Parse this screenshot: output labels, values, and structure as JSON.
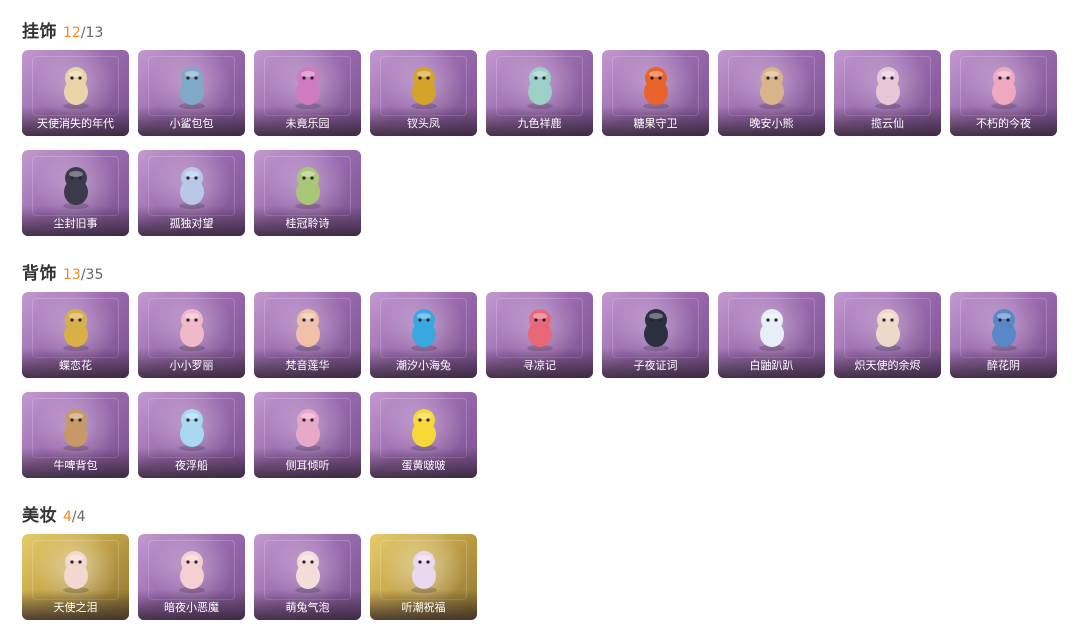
{
  "sections": [
    {
      "title": "挂饰",
      "owned": "12",
      "total": "/13",
      "items": [
        {
          "label": "天使消失的年代",
          "icon": "angel-figure-icon",
          "color": "#e8d4a8"
        },
        {
          "label": "小鲨包包",
          "icon": "shark-bag-icon",
          "color": "#7fa9c9"
        },
        {
          "label": "未竟乐园",
          "icon": "fairy-figure-icon",
          "color": "#d07ac0"
        },
        {
          "label": "钗头凤",
          "icon": "phoenix-hairpin-icon",
          "color": "#d4a32a"
        },
        {
          "label": "九色祥鹿",
          "icon": "deer-charm-icon",
          "color": "#9cd0c8"
        },
        {
          "label": "糖果守卫",
          "icon": "pumpkin-lantern-icon",
          "color": "#e8642a"
        },
        {
          "label": "晚安小熊",
          "icon": "teddy-bear-icon",
          "color": "#d9b48a"
        },
        {
          "label": "揽云仙",
          "icon": "cloud-fairy-icon",
          "color": "#e8c8d8"
        },
        {
          "label": "不朽的今夜",
          "icon": "cat-cake-icon",
          "color": "#f0a8c0"
        },
        {
          "label": "尘封旧事",
          "icon": "crowned-boy-icon",
          "color": "#3a3a4a"
        },
        {
          "label": "孤独对望",
          "icon": "blue-doll-icon",
          "color": "#b8c8e8"
        },
        {
          "label": "桂冠聆诗",
          "icon": "laurel-doll-icon",
          "color": "#a8c878"
        }
      ]
    },
    {
      "title": "背饰",
      "owned": "13",
      "total": "/35",
      "items": [
        {
          "label": "蝶恋花",
          "icon": "golden-lantern-icon",
          "color": "#d8b048"
        },
        {
          "label": "小小罗丽",
          "icon": "lolita-doll-icon",
          "color": "#f0b8c8"
        },
        {
          "label": "梵音莲华",
          "icon": "lotus-girl-icon",
          "color": "#f0c0a8"
        },
        {
          "label": "潮汐小海兔",
          "icon": "sea-bunny-icon",
          "color": "#38a8e0"
        },
        {
          "label": "寻凉记",
          "icon": "sunhat-bear-icon",
          "color": "#e86878"
        },
        {
          "label": "子夜证词",
          "icon": "owl-detective-icon",
          "color": "#2a3040"
        },
        {
          "label": "白鼬趴趴",
          "icon": "ermine-icon",
          "color": "#e8eef8"
        },
        {
          "label": "炽天使的余烬",
          "icon": "seraph-doll-icon",
          "color": "#f0d8c8"
        },
        {
          "label": "醉花阴",
          "icon": "flower-wreath-icon",
          "color": "#5888c8"
        },
        {
          "label": "牛啤背包",
          "icon": "cow-barrel-icon",
          "color": "#c89868"
        },
        {
          "label": "夜浮船",
          "icon": "jellyfish-icon",
          "color": "#a8d8f0"
        },
        {
          "label": "侧耳倾听",
          "icon": "lily-branch-icon",
          "color": "#e8a8c8"
        },
        {
          "label": "蛋黄啵啵",
          "icon": "egg-chick-icon",
          "color": "#f8d838"
        }
      ]
    },
    {
      "title": "美妆",
      "owned": "4",
      "total": "/4",
      "items": [
        {
          "label": "天使之泪",
          "icon": "halo-face-icon",
          "color": "#f4d8d0",
          "gold": true
        },
        {
          "label": "暗夜小恶魔",
          "icon": "devil-horns-face-icon",
          "color": "#f4d0d0"
        },
        {
          "label": "萌兔气泡",
          "icon": "bunny-bubble-face-icon",
          "color": "#f4dcd8"
        },
        {
          "label": "听潮祝福",
          "icon": "wave-blessing-face-icon",
          "color": "#e8d8f0",
          "gold": true
        }
      ]
    }
  ]
}
